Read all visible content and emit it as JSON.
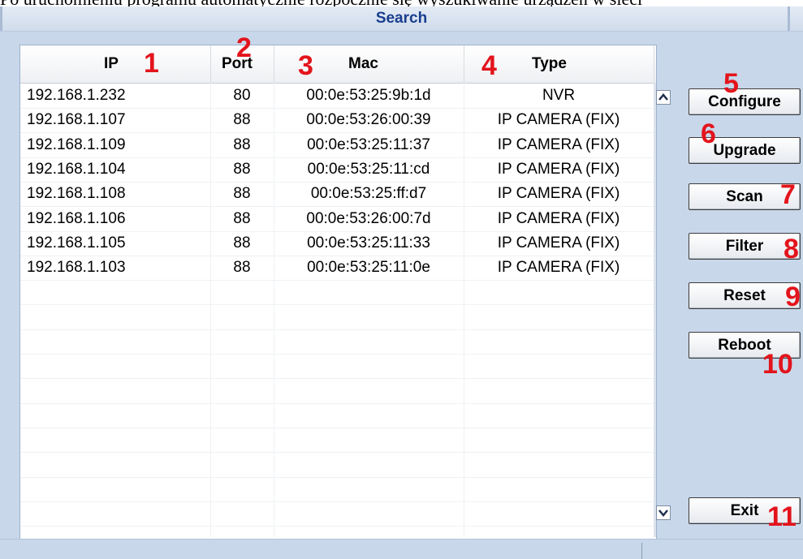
{
  "top_text": "Po uruchomieniu programu automatycznie rozpocznie się wyszukiwanie urządzeń w sieci",
  "window": {
    "title": "Search"
  },
  "columns": [
    {
      "label": "IP",
      "marker": "1"
    },
    {
      "label": "Port",
      "marker": "2"
    },
    {
      "label": "Mac",
      "marker": "3"
    },
    {
      "label": "Type",
      "marker": "4"
    }
  ],
  "rows": [
    {
      "ip": "192.168.1.232",
      "port": "80",
      "mac": "00:0e:53:25:9b:1d",
      "type": "NVR"
    },
    {
      "ip": "192.168.1.107",
      "port": "88",
      "mac": "00:0e:53:26:00:39",
      "type": "IP CAMERA (FIX)"
    },
    {
      "ip": "192.168.1.109",
      "port": "88",
      "mac": "00:0e:53:25:11:37",
      "type": "IP CAMERA (FIX)"
    },
    {
      "ip": "192.168.1.104",
      "port": "88",
      "mac": "00:0e:53:25:11:cd",
      "type": "IP CAMERA (FIX)"
    },
    {
      "ip": "192.168.1.108",
      "port": "88",
      "mac": "00:0e:53:25:ff:d7",
      "type": "IP CAMERA (FIX)"
    },
    {
      "ip": "192.168.1.106",
      "port": "88",
      "mac": "00:0e:53:26:00:7d",
      "type": "IP CAMERA (FIX)"
    },
    {
      "ip": "192.168.1.105",
      "port": "88",
      "mac": "00:0e:53:25:11:33",
      "type": "IP CAMERA (FIX)"
    },
    {
      "ip": "192.168.1.103",
      "port": "88",
      "mac": "00:0e:53:25:11:0e",
      "type": "IP CAMERA (FIX)"
    }
  ],
  "buttons": {
    "configure": {
      "label": "Configure",
      "marker": "5"
    },
    "upgrade": {
      "label": "Upgrade",
      "marker": "6"
    },
    "scan": {
      "label": "Scan",
      "marker": "7"
    },
    "filter": {
      "label": "Filter",
      "marker": "8"
    },
    "reset": {
      "label": "Reset",
      "marker": "9"
    },
    "reboot": {
      "label": "Reboot",
      "marker": "10"
    },
    "exit": {
      "label": "Exit",
      "marker": "11"
    }
  },
  "icons": {
    "scroll_up": "chevron-up-icon",
    "scroll_down": "chevron-down-icon"
  },
  "colors": {
    "marker": "#e3141c",
    "title": "#1a3d8f",
    "window_bg": "#c8d7ea"
  }
}
